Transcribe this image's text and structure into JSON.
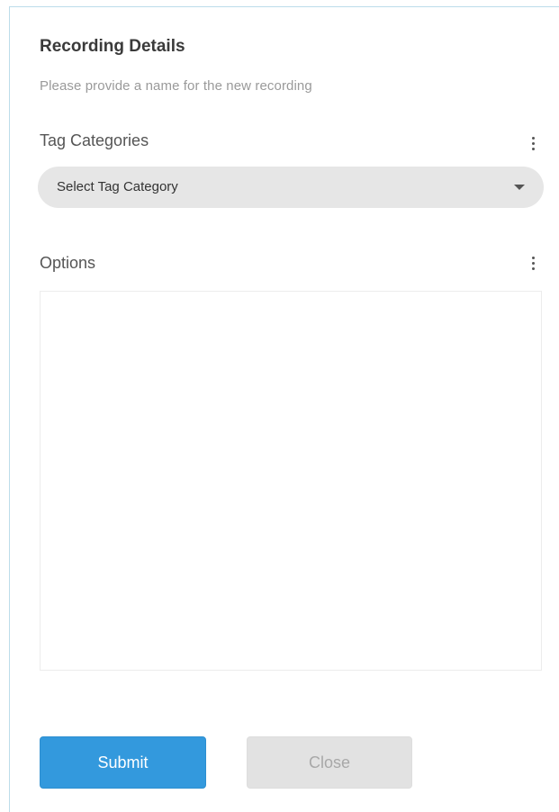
{
  "dialog": {
    "title": "Recording Details",
    "subtitle": "Please provide a name for the new recording"
  },
  "tag_categories": {
    "label": "Tag Categories",
    "menu_icon": "kebab-menu-icon",
    "select": {
      "selected_value": "Select Tag Category",
      "caret_icon": "caret-down-icon"
    }
  },
  "options": {
    "label": "Options",
    "menu_icon": "kebab-menu-icon"
  },
  "actions": {
    "submit_label": "Submit",
    "close_label": "Close"
  },
  "colors": {
    "primary": "#3399dd",
    "secondary_bg": "#e2e2e2",
    "select_bg": "#e6e6e6",
    "panel_border": "#bcdcea"
  }
}
